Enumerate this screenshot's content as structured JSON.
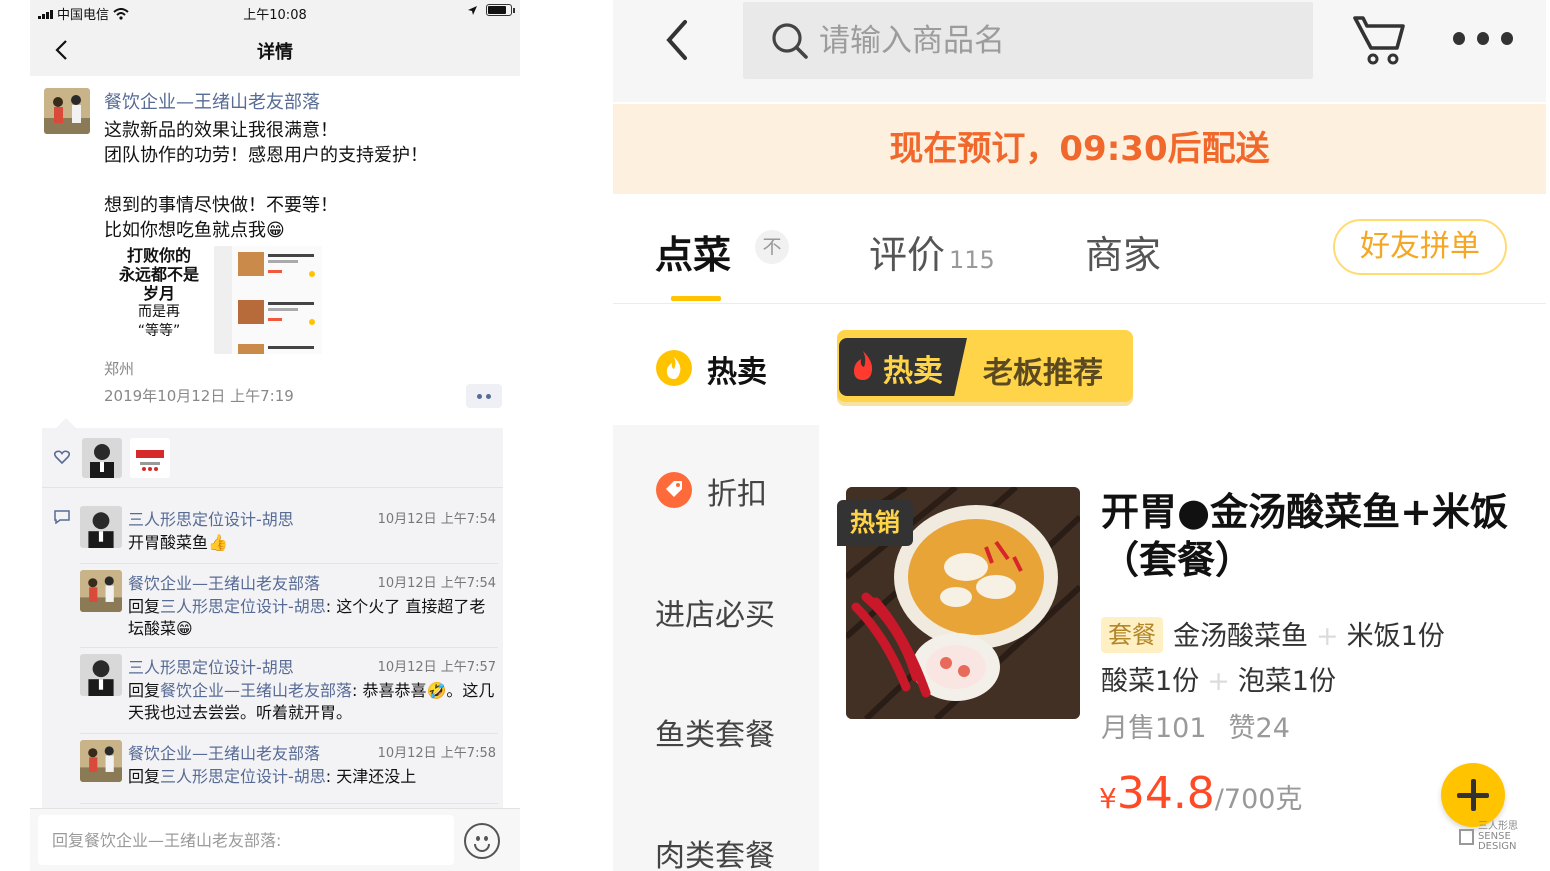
{
  "left": {
    "status_bar": {
      "carrier": "中国电信",
      "time": "上午10:08"
    },
    "nav": {
      "title": "详情"
    },
    "post": {
      "author": "餐饮企业—王绪山老友部落",
      "lines": [
        "这款新品的效果让我很满意！",
        "团队协作的功劳！感恩用户的支持爱护！",
        "",
        "想到的事情尽快做！不要等！",
        "比如你想吃鱼就点我😁"
      ],
      "poster_lines": [
        "打败你的",
        "永远都不是",
        "岁月",
        "而是再",
        "“等等”"
      ],
      "location": "郑州",
      "time": "2019年10月12日 上午7:19"
    },
    "comments": [
      {
        "name": "三人形思定位设计-胡思",
        "time": "10月12日 上午7:54",
        "prefix": "",
        "reply_to": "",
        "text": "开胃酸菜鱼👍"
      },
      {
        "name": "餐饮企业—王绪山老友部落",
        "time": "10月12日 上午7:54",
        "prefix": "回复",
        "reply_to": "三人形思定位设计-胡思",
        "text": ": 这个火了 直接超了老坛酸菜😁"
      },
      {
        "name": "三人形思定位设计-胡思",
        "time": "10月12日 上午7:57",
        "prefix": "回复",
        "reply_to": "餐饮企业—王绪山老友部落",
        "text": ": 恭喜恭喜🤣。这几天我也过去尝尝。听着就开胃。"
      },
      {
        "name": "餐饮企业—王绪山老友部落",
        "time": "10月12日 上午7:58",
        "prefix": "回复",
        "reply_to": "三人形思定位设计-胡思",
        "text": ": 天津还没上"
      }
    ],
    "reply_placeholder": "回复餐饮企业—王绪山老友部落:"
  },
  "right": {
    "search_placeholder": "请输入商品名",
    "notice": "现在预订，09:30后配送",
    "tabs": {
      "order": "点菜",
      "order_badge": "不",
      "reviews": "评价",
      "reviews_count": "115",
      "merchant": "商家",
      "group": "好友拼单"
    },
    "categories": [
      "热卖",
      "折扣",
      "进店必买",
      "鱼类套餐",
      "肉类套餐"
    ],
    "banner": {
      "hot": "热卖",
      "recommend": "老板推荐"
    },
    "dish": {
      "tag": "热销",
      "title": "开胃●金汤酸菜鱼+米饭（套餐）",
      "set_tag": "套餐",
      "items_line1": [
        "金汤酸菜鱼",
        "米饭1份"
      ],
      "items_line2": [
        "酸菜1份",
        "泡菜1份"
      ],
      "monthly_sales": "月售101",
      "likes": "赞24",
      "currency": "¥",
      "price": "34.8",
      "unit": "/700克"
    },
    "watermark": [
      "三人形思",
      "SENSE DESIGN"
    ]
  },
  "colors": {
    "wechat_link": "#576b95",
    "accent_yellow": "#ffc300",
    "notice_text": "#f0682c",
    "price": "#ff4a26"
  }
}
